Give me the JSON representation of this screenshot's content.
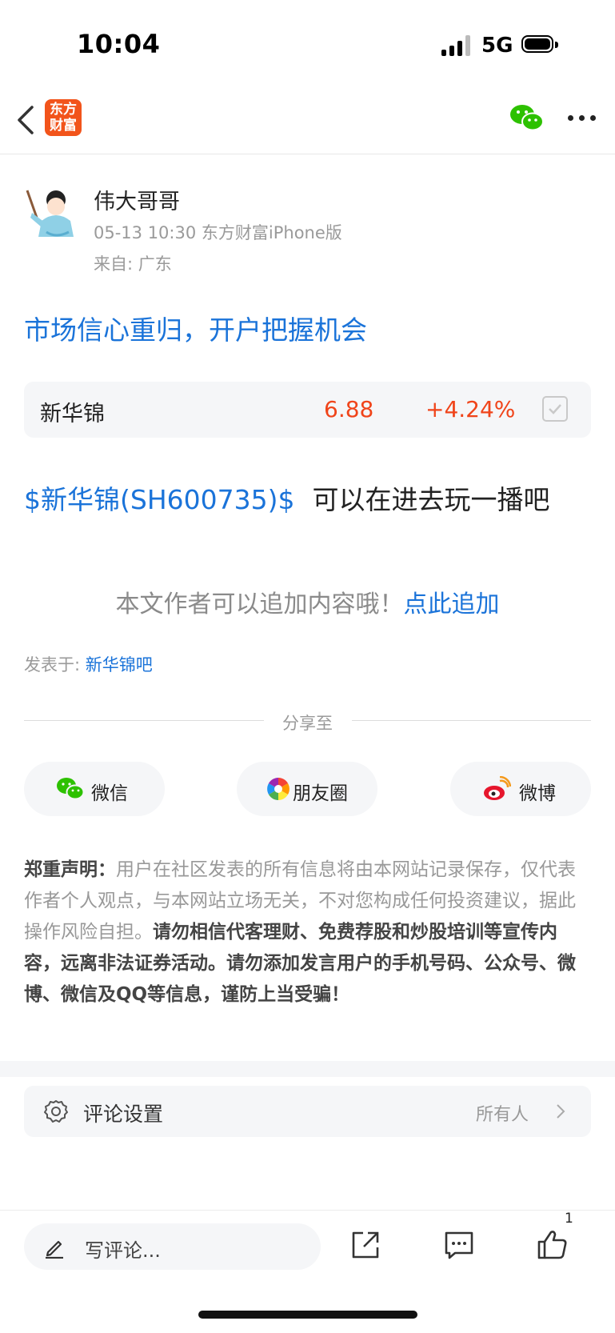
{
  "status": {
    "time": "10:04",
    "network": "5G"
  },
  "nav": {
    "logo_line1": "东方",
    "logo_line2": "财富"
  },
  "author": {
    "name": "伟大哥哥",
    "meta": "05-13 10:30 东方财富iPhone版",
    "location": "来自: 广东"
  },
  "post": {
    "title": "市场信心重归，开户把握机会",
    "body_tag": "$新华锦(SH600735)$",
    "body_text": "可以在进去玩一播吧"
  },
  "stock": {
    "name": "新华锦",
    "price": "6.88",
    "change": "+4.24%",
    "color": "#f0441a"
  },
  "append": {
    "text": "本文作者可以追加内容哦！",
    "link": "点此追加"
  },
  "posted_in": {
    "label": "发表于: ",
    "bar": "新华锦吧"
  },
  "share": {
    "title": "分享至",
    "wechat": "微信",
    "moments": "朋友圈",
    "weibo": "微博"
  },
  "disclaimer": {
    "heading": "郑重声明：",
    "normal": "用户在社区发表的所有信息将由本网站记录保存，仅代表作者个人观点，与本网站立场无关，不对您构成任何投资建议，据此操作风险自担。",
    "bold": "请勿相信代客理财、免费荐股和炒股培训等宣传内容，远离非法证券活动。请勿添加发言用户的手机号码、公众号、微博、微信及QQ等信息，谨防上当受骗！"
  },
  "comment_settings": {
    "label": "评论设置",
    "value": "所有人"
  },
  "bottom": {
    "placeholder": "写评论...",
    "like_count": "1"
  },
  "colors": {
    "accent": "#1a73d9",
    "up": "#f0441a",
    "brand": "#f2541b",
    "wechat": "#2dc100"
  }
}
